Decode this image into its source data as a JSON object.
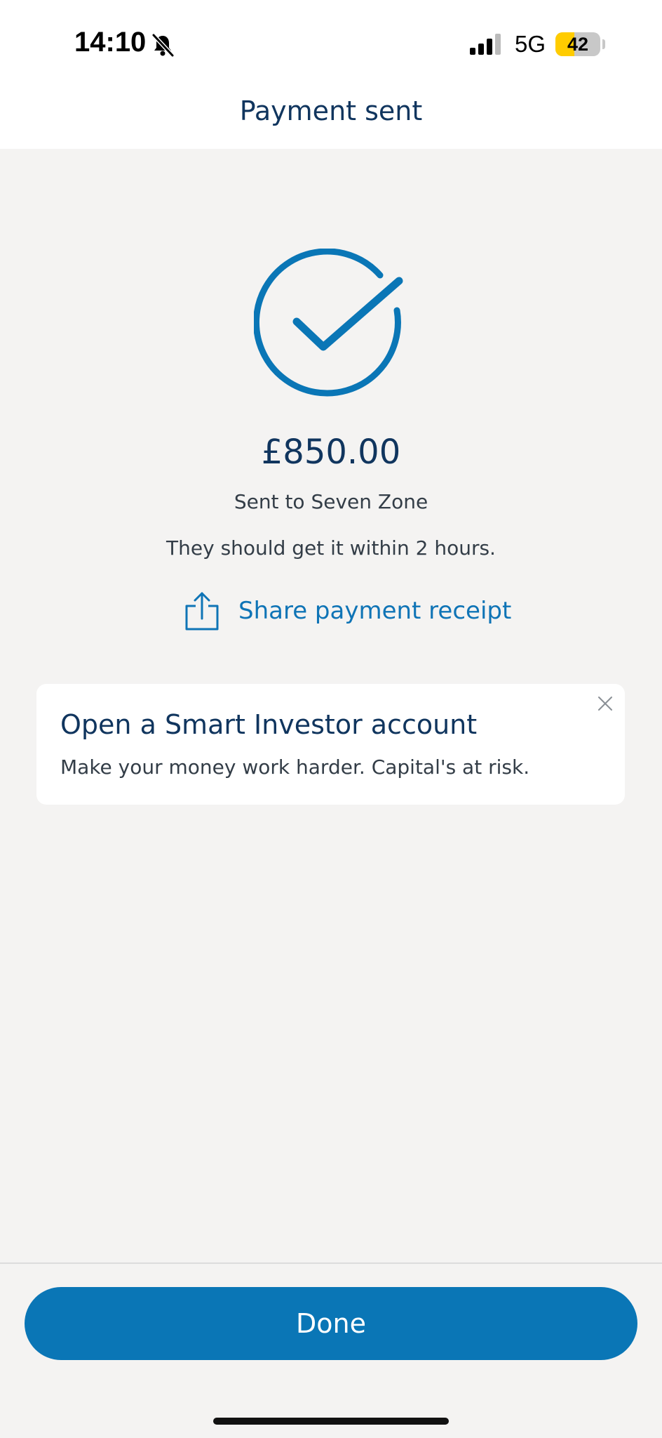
{
  "status_bar": {
    "time": "14:10",
    "network": "5G",
    "battery_level": "42",
    "battery_fraction": 0.42,
    "battery_color": "#ffcc00",
    "signal_bars": 3,
    "silent_mode": true
  },
  "header": {
    "title": "Payment sent"
  },
  "confirmation": {
    "icon": "checkmark-circle-icon",
    "amount": "£850.00",
    "recipient_text": "Sent to Seven Zone",
    "eta_text": "They should get it within 2 hours.",
    "share_label": "Share payment receipt",
    "share_icon": "share-icon"
  },
  "promo": {
    "title": "Open a Smart Investor account",
    "text": "Make your money work harder. Capital's at risk.",
    "close_icon": "close-icon"
  },
  "footer": {
    "done_label": "Done"
  },
  "colors": {
    "accent": "#0a76b6",
    "heading": "#10355e",
    "background": "#f4f3f2"
  }
}
